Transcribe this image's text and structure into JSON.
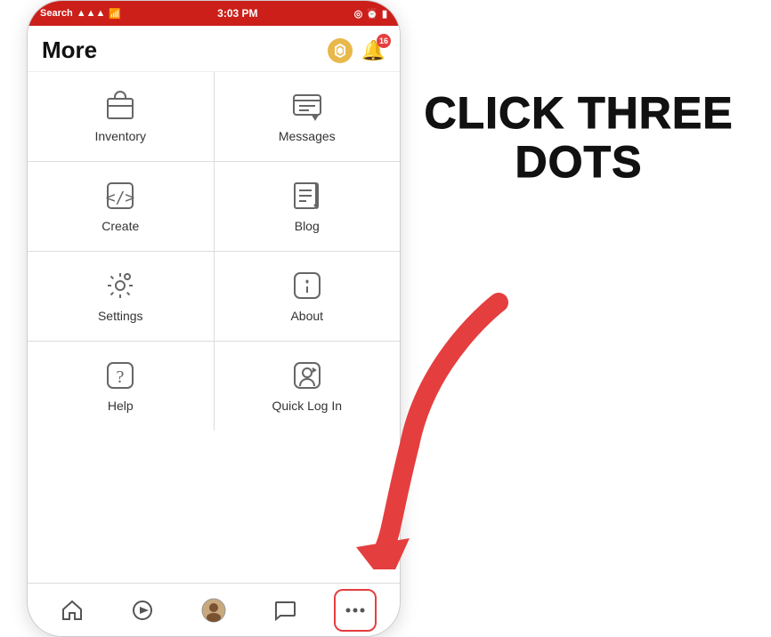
{
  "statusBar": {
    "left": "Search",
    "time": "3:03 PM",
    "signalIcon": "📶",
    "batteryIcon": "🔋"
  },
  "header": {
    "title": "More",
    "robuxSymbol": "⬡",
    "notificationCount": "16"
  },
  "menuItems": [
    {
      "id": "inventory",
      "label": "Inventory",
      "icon": "inventory"
    },
    {
      "id": "messages",
      "label": "Messages",
      "icon": "messages"
    },
    {
      "id": "create",
      "label": "Create",
      "icon": "create"
    },
    {
      "id": "blog",
      "label": "Blog",
      "icon": "blog"
    },
    {
      "id": "settings",
      "label": "Settings",
      "icon": "settings"
    },
    {
      "id": "about",
      "label": "About",
      "icon": "about"
    },
    {
      "id": "help",
      "label": "Help",
      "icon": "help"
    },
    {
      "id": "quicklogin",
      "label": "Quick Log In",
      "icon": "quicklogin"
    }
  ],
  "bottomNav": [
    {
      "id": "home",
      "label": "Home",
      "icon": "home"
    },
    {
      "id": "play",
      "label": "Play",
      "icon": "play"
    },
    {
      "id": "avatar",
      "label": "Avatar",
      "icon": "avatar"
    },
    {
      "id": "chat",
      "label": "Chat",
      "icon": "chat"
    },
    {
      "id": "more",
      "label": "More",
      "icon": "more",
      "active": true
    }
  ],
  "annotation": {
    "line1": "CLICK THREE",
    "line2": "DOTS"
  }
}
